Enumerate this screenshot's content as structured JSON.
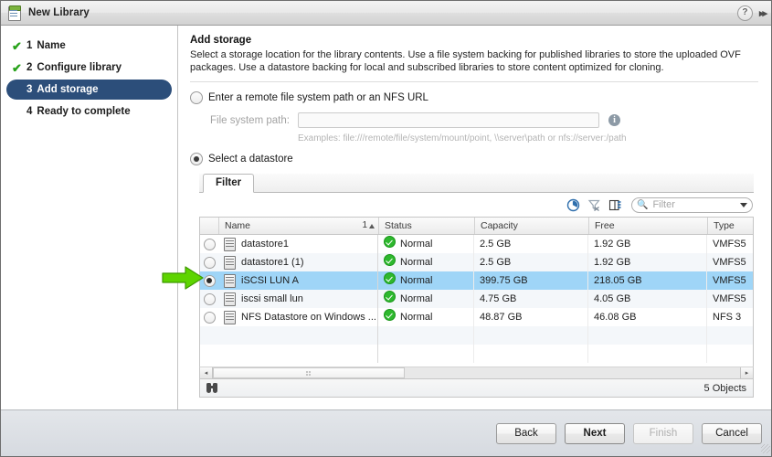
{
  "window": {
    "title": "New Library",
    "app_icon": "library-icon",
    "help_label": "?",
    "collapse_label": "▸▸"
  },
  "wizard_steps": [
    {
      "num": "1",
      "label": "Name",
      "state": "done",
      "check": "✔"
    },
    {
      "num": "2",
      "label": "Configure library",
      "state": "done",
      "check": "✔"
    },
    {
      "num": "3",
      "label": "Add storage",
      "state": "active",
      "check": ""
    },
    {
      "num": "4",
      "label": "Ready to complete",
      "state": "pending",
      "check": ""
    }
  ],
  "content": {
    "heading": "Add storage",
    "description": "Select a storage location for the library contents. Use a file system backing for published libraries to store the uploaded OVF packages. Use a datastore backing for local and subscribed libraries to store content optimized for cloning.",
    "option_remote": {
      "label": "Enter a remote file system path or an NFS URL",
      "selected": false
    },
    "file_system_path": {
      "label": "File system path:",
      "value": "",
      "placeholder": "",
      "info_icon": "info-icon",
      "examples": "Examples: file:///remote/file/system/mount/point, \\\\server\\path or nfs://server:/path"
    },
    "option_datastore": {
      "label": "Select a datastore",
      "selected": true
    }
  },
  "filter_panel": {
    "tab_label": "Filter",
    "toolbar_icons": [
      "recent-tasks-icon",
      "clear-filter-icon",
      "show-columns-icon"
    ],
    "search": {
      "placeholder": "Filter",
      "value": "",
      "icon": "search-icon",
      "dropdown_icon": "chevron-down-icon"
    }
  },
  "table": {
    "columns": [
      "Name",
      "Status",
      "Capacity",
      "Free",
      "Type"
    ],
    "sort_column": "Name",
    "sort_indicator": "1",
    "sort_direction": "asc",
    "rows": [
      {
        "selected": false,
        "name": "datastore1",
        "status": "Normal",
        "capacity": "2.5  GB",
        "free": "1.92  GB",
        "type": "VMFS5"
      },
      {
        "selected": false,
        "name": "datastore1 (1)",
        "status": "Normal",
        "capacity": "2.5  GB",
        "free": "1.92  GB",
        "type": "VMFS5"
      },
      {
        "selected": true,
        "name": "iSCSI LUN A",
        "status": "Normal",
        "capacity": "399.75  GB",
        "free": "218.05  GB",
        "type": "VMFS5"
      },
      {
        "selected": false,
        "name": "iscsi small lun",
        "status": "Normal",
        "capacity": "4.75  GB",
        "free": "4.05  GB",
        "type": "VMFS5"
      },
      {
        "selected": false,
        "name": "NFS Datastore on Windows ...",
        "status": "Normal",
        "capacity": "48.87  GB",
        "free": "46.08  GB",
        "type": "NFS 3"
      }
    ],
    "object_count": "5 Objects",
    "status_icon": "binoculars-icon",
    "scroll_left_icon": "◂",
    "scroll_right_icon": "▸"
  },
  "footer": {
    "back": "Back",
    "next": "Next",
    "finish": "Finish",
    "cancel": "Cancel"
  },
  "annotation": {
    "arrow": "green-arrow-pointer",
    "arrow_color": "#5ed400"
  },
  "colors": {
    "active_step": "#2c4e7a",
    "selected_row": "#9fd5f7",
    "status_ok": "#2eb82e",
    "arrow_green": "#5ed400"
  }
}
